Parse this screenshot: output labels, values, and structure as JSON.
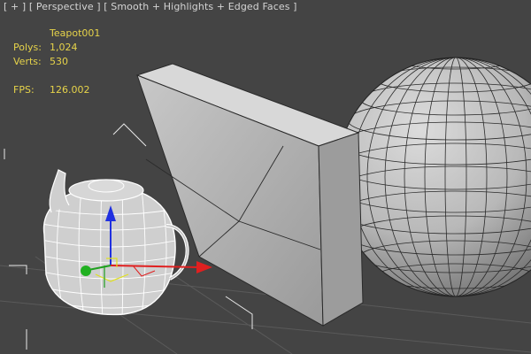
{
  "viewport": {
    "label": "[ + ] [ Perspective ] [ Smooth + Highlights + Edged Faces ]",
    "background": "#444444"
  },
  "stats": {
    "object_name": "Teapot001",
    "rows": [
      {
        "label": "Polys:",
        "value": "1,024"
      },
      {
        "label": "Verts:",
        "value": "530"
      },
      {
        "label": "FPS:",
        "value": "126.002"
      }
    ],
    "text_color": "#e6d34a"
  },
  "scene": {
    "objects": [
      "teapot-wireframe",
      "box-plane",
      "sphere"
    ],
    "gizmo_axis_colors": {
      "x": "#e02020",
      "y": "#20a020",
      "z": "#2030e0"
    }
  }
}
